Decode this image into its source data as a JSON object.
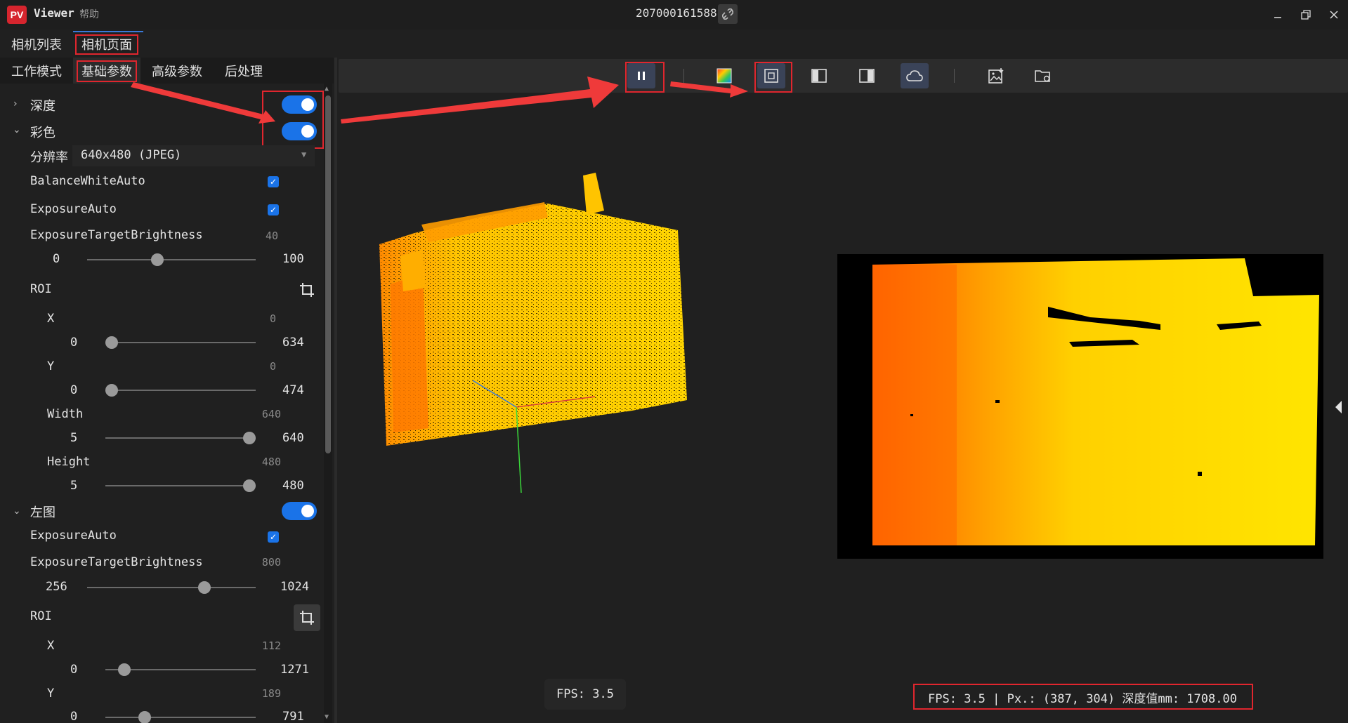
{
  "app": {
    "logo": "PV",
    "title": "Viewer",
    "help_menu": "帮助",
    "serial": "207000161588"
  },
  "page_tabs": [
    {
      "label": "相机列表"
    },
    {
      "label": "相机页面"
    }
  ],
  "sub_tabs": [
    {
      "label": "工作模式"
    },
    {
      "label": "基础参数"
    },
    {
      "label": "高级参数"
    },
    {
      "label": "后处理"
    }
  ],
  "sections": {
    "depth": {
      "label": "深度",
      "enabled": true
    },
    "color": {
      "label": "彩色",
      "enabled": true,
      "resolution_label": "分辨率",
      "resolution_value": "640x480 (JPEG)",
      "balance_white_auto": "BalanceWhiteAuto",
      "exposure_auto": "ExposureAuto",
      "exposure_target": {
        "label": "ExposureTargetBrightness",
        "value": "40",
        "min": "0",
        "max": "100",
        "fraction": 0.41
      },
      "roi_label": "ROI",
      "roi": [
        {
          "label": "X",
          "value": "0",
          "min": "0",
          "max": "634",
          "fraction": 0.0
        },
        {
          "label": "Y",
          "value": "0",
          "min": "0",
          "max": "474",
          "fraction": 0.0
        },
        {
          "label": "Width",
          "value": "640",
          "min": "5",
          "max": "640",
          "fraction": 1.0
        },
        {
          "label": "Height",
          "value": "480",
          "min": "5",
          "max": "480",
          "fraction": 1.0
        }
      ]
    },
    "left": {
      "label": "左图",
      "enabled": true,
      "exposure_auto": "ExposureAuto",
      "exposure_target": {
        "label": "ExposureTargetBrightness",
        "value": "800",
        "min": "256",
        "max": "1024",
        "fraction": 0.71
      },
      "roi_label": "ROI",
      "roi": [
        {
          "label": "X",
          "value": "112",
          "min": "0",
          "max": "1271",
          "fraction": 0.09
        },
        {
          "label": "Y",
          "value": "189",
          "min": "0",
          "max": "791",
          "fraction": 0.24
        }
      ]
    }
  },
  "status": {
    "fps_left": "FPS:  3.5",
    "fps_right": "FPS:  3.5 | Px.: (387, 304) 深度值mm: 1708.00"
  },
  "colors": {
    "accent": "#1a73e8",
    "highlight": "#e0262e",
    "logo": "#d6252e"
  }
}
